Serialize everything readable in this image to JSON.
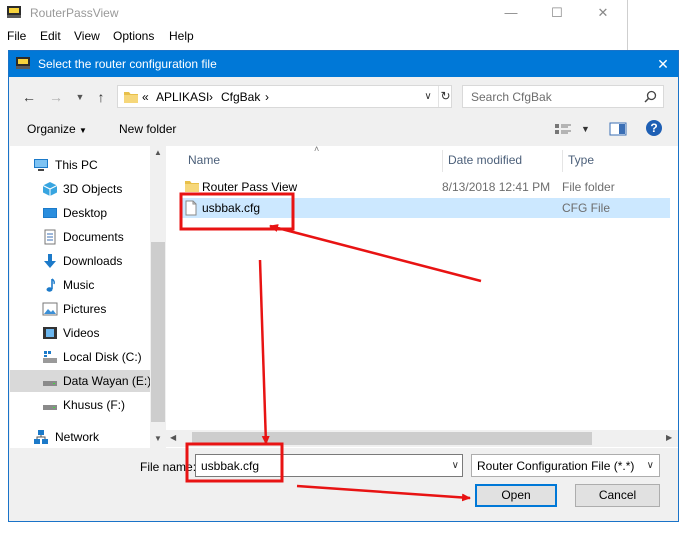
{
  "parent_window": {
    "title": "RouterPassView",
    "menu": [
      "File",
      "Edit",
      "View",
      "Options",
      "Help"
    ]
  },
  "dialog": {
    "title": "Select the router configuration file",
    "breadcrumb": {
      "overflow": "«",
      "parts": [
        "APLIKASI",
        "CfgBak"
      ],
      "separator": "›"
    },
    "search_placeholder": "Search CfgBak",
    "toolbar": {
      "organize": "Organize",
      "new_folder": "New folder"
    },
    "nav_pane": [
      {
        "label": "This PC",
        "icon": "computer-icon"
      },
      {
        "label": "3D Objects",
        "icon": "3d-objects-icon"
      },
      {
        "label": "Desktop",
        "icon": "desktop-icon"
      },
      {
        "label": "Documents",
        "icon": "documents-icon"
      },
      {
        "label": "Downloads",
        "icon": "downloads-icon"
      },
      {
        "label": "Music",
        "icon": "music-icon"
      },
      {
        "label": "Pictures",
        "icon": "pictures-icon"
      },
      {
        "label": "Videos",
        "icon": "videos-icon"
      },
      {
        "label": "Local Disk (C:)",
        "icon": "local-disk-icon"
      },
      {
        "label": "Data Wayan (E:)",
        "icon": "drive-icon",
        "selected": true
      },
      {
        "label": "Khusus (F:)",
        "icon": "drive-icon"
      },
      {
        "label": "Network",
        "icon": "network-icon"
      }
    ],
    "columns": [
      "Name",
      "Date modified",
      "Type"
    ],
    "files": [
      {
        "name": "Router Pass View",
        "date": "8/13/2018 12:41 PM",
        "type": "File folder",
        "icon": "folder-icon"
      },
      {
        "name": "usbbak.cfg",
        "date": "",
        "type": "CFG File",
        "icon": "file-icon",
        "selected": true
      }
    ],
    "file_name_label": "File name:",
    "file_name_value": "usbbak.cfg",
    "file_type_value": "Router Configuration File (*.*)",
    "open_label": "Open",
    "cancel_label": "Cancel",
    "annotation_color": "#e81313",
    "accent_color": "#0078d7"
  }
}
